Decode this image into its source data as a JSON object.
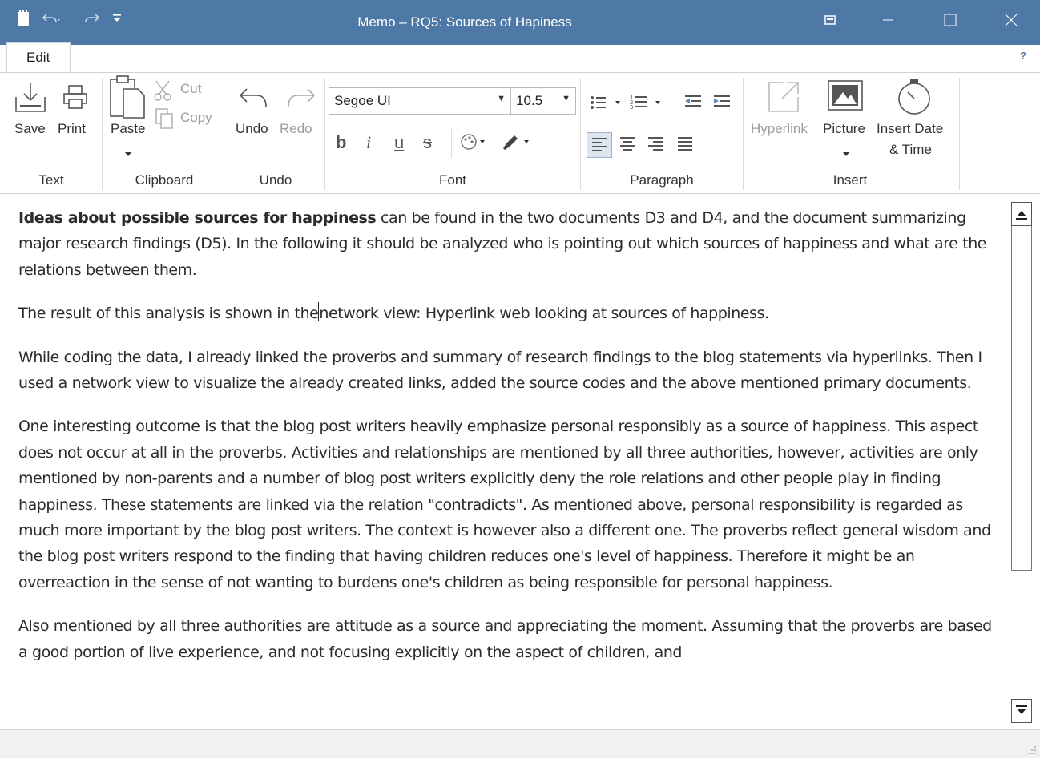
{
  "window": {
    "title": "Memo – RQ5: Sources of Hapiness",
    "accent": "#4e78a5"
  },
  "quick_access": {
    "icons": [
      "memo-icon",
      "undo-icon",
      "redo-icon",
      "customize-dropdown-icon"
    ]
  },
  "ribbon": {
    "tab": "Edit",
    "groups": {
      "text": {
        "label": "Text",
        "save": "Save",
        "print": "Print"
      },
      "clipboard": {
        "label": "Clipboard",
        "paste": "Paste",
        "cut": "Cut",
        "copy": "Copy"
      },
      "undo": {
        "label": "Undo",
        "undo": "Undo",
        "redo": "Redo"
      },
      "font": {
        "label": "Font",
        "font_family": "Segoe UI",
        "font_size": "10.5",
        "bold": "b",
        "italic": "i",
        "underline": "u",
        "strike": "s"
      },
      "paragraph": {
        "label": "Paragraph",
        "active_alignment": "left"
      },
      "insert": {
        "label": "Insert",
        "hyperlink": "Hyperlink",
        "picture": "Picture",
        "insert_date_line1": "Insert Date",
        "insert_date_line2": "& Time"
      }
    }
  },
  "document": {
    "p1_bold": "Ideas about possible sources for happiness",
    "p1_rest": " can be found in the two documents D3 and D4, and the document summarizing major research findings (D5). In the following it should be analyzed who is pointing out which sources of happiness and what are the relations between them.",
    "p2_before_caret": "The result of this analysis is shown in the",
    "p2_after_caret": "network view: Hyperlink web looking at sources of happiness.",
    "p3": "While coding the data, I already linked the proverbs and summary of research findings to the blog statements via hyperlinks. Then I used a network view to visualize the already created links, added the source codes and the above mentioned primary documents.",
    "p4": "One interesting outcome is that the blog post writers heavily emphasize personal responsibly as a source of happiness. This aspect does not occur at all in the proverbs. Activities and relationships are mentioned by all three authorities, however, activities are only mentioned by non-parents and a number of blog post writers explicitly deny the role relations and other people play in finding happiness. These statements are linked via the relation \"contradicts\".  As mentioned above, personal responsibility is regarded as much more important by the blog post writers. The context is however also a different one. The proverbs reflect general wisdom and the blog post writers respond to the finding that having children reduces one's level of happiness. Therefore it might be an overreaction in the sense of not wanting to burdens one's children as being responsible for personal happiness.",
    "p5": "Also mentioned by all three authorities are attitude as a source and appreciating the moment. Assuming that the proverbs are based a good portion of live experience, and not focusing explicitly on the aspect of children, and"
  }
}
